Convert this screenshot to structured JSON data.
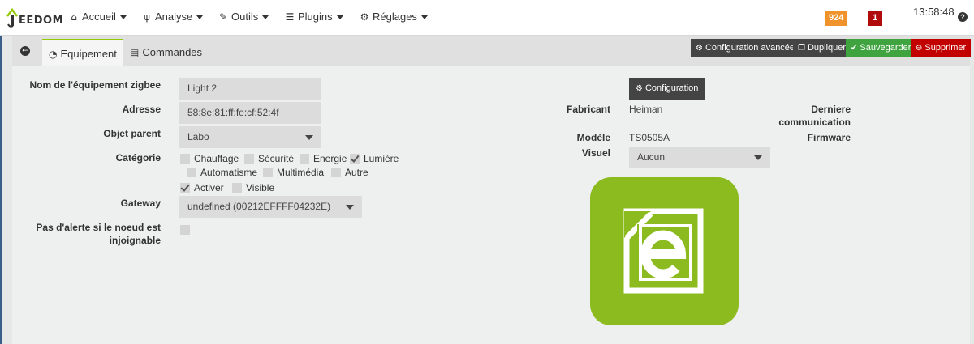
{
  "app": {
    "logo_text": "EEDOM"
  },
  "nav": {
    "items": [
      {
        "label": "Accueil",
        "icon": "home-icon"
      },
      {
        "label": "Analyse",
        "icon": "stethoscope-icon"
      },
      {
        "label": "Outils",
        "icon": "wrench-icon"
      },
      {
        "label": "Plugins",
        "icon": "list-icon"
      },
      {
        "label": "Réglages",
        "icon": "gear-icon"
      }
    ],
    "badge_warning": "924",
    "badge_danger": "1",
    "time": "13:58:48",
    "help": "?"
  },
  "tabs": {
    "equipement": "Equipement",
    "commandes": "Commandes"
  },
  "actions": {
    "advanced_config": "Configuration avancée",
    "duplicate": "Dupliquer",
    "save": "Sauvegarder",
    "delete": "Supprimer",
    "colors": {
      "dark": "#444444",
      "save": "#3fa33f",
      "delete": "#c20000"
    }
  },
  "form": {
    "name_label": "Nom de l'équipement zigbee",
    "name_value": "Light 2",
    "address_label": "Adresse",
    "address_value": "58:8e:81:ff:fe:cf:52:4f",
    "parent_label": "Objet parent",
    "parent_value": "Labo",
    "category_label": "Catégorie",
    "categories": [
      {
        "label": "Chauffage",
        "checked": false
      },
      {
        "label": "Sécurité",
        "checked": false
      },
      {
        "label": "Energie",
        "checked": false
      },
      {
        "label": "Lumière",
        "checked": true
      },
      {
        "label": "Automatisme",
        "checked": false
      },
      {
        "label": "Multimédia",
        "checked": false
      },
      {
        "label": "Autre",
        "checked": false
      }
    ],
    "activate_label": "Activer",
    "activate_checked": true,
    "visible_label": "Visible",
    "visible_checked": false,
    "gateway_label": "Gateway",
    "gateway_value": "undefined (00212EFFFF04232E)",
    "alert_label_1": "Pas d'alerte si le noeud est",
    "alert_label_2": "injoignable"
  },
  "info": {
    "config_button": "Configuration",
    "manufacturer_label": "Fabricant",
    "manufacturer_value": "Heiman",
    "model_label": "Modèle",
    "model_value": "TS0505A",
    "visual_label": "Visuel",
    "visual_value": "Aucun",
    "last_comm_label_1": "Derniere",
    "last_comm_label_2": "communication",
    "firmware_label": "Firmware",
    "image_icon": "jeedom-logo-icon",
    "image_color": "#8cbb1f"
  }
}
